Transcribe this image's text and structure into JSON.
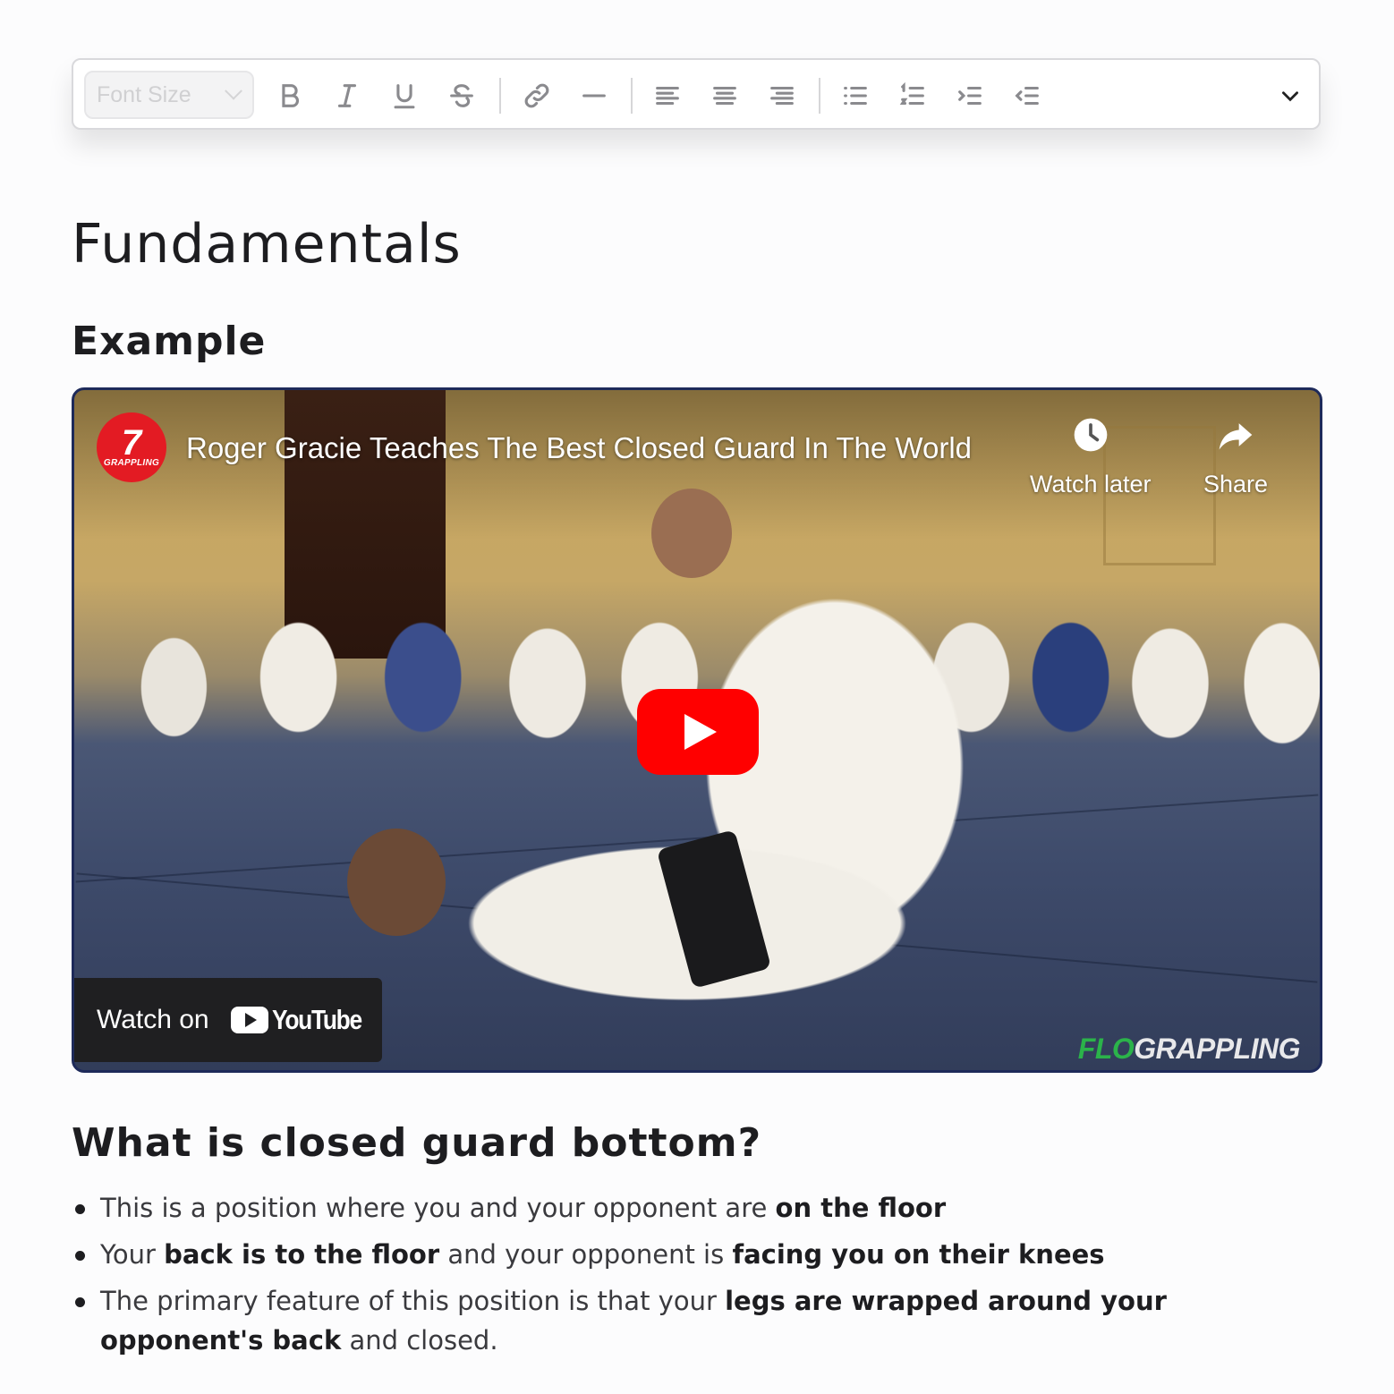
{
  "toolbar": {
    "font_size_placeholder": "Font Size",
    "buttons": [
      "bold",
      "italic",
      "underline",
      "strikethrough",
      "link",
      "horizontal-rule",
      "align-left",
      "align-center",
      "align-right",
      "bullet-list",
      "numbered-list",
      "indent",
      "outdent",
      "more"
    ]
  },
  "document": {
    "title": "Fundamentals",
    "section_example": "Example",
    "section_question": "What is closed guard bottom?"
  },
  "video": {
    "channel_logo_text": "GRAPPLING",
    "title": "Roger Gracie Teaches The Best Closed Guard In The World",
    "watch_later_label": "Watch later",
    "share_label": "Share",
    "watch_on_label": "Watch on",
    "youtube_label": "YouTube",
    "watermark_flo": "FLO",
    "watermark_grappling": "GRAPPLING",
    "colors": {
      "play_button": "#ff0000",
      "channel_red": "#e31b23",
      "flo_green": "#2bb34a",
      "border": "#1e2a5a"
    }
  },
  "bullets": [
    {
      "parts": [
        {
          "t": "This is a position where you and your opponent are ",
          "b": false
        },
        {
          "t": "on the floor",
          "b": true
        }
      ]
    },
    {
      "parts": [
        {
          "t": "Your ",
          "b": false
        },
        {
          "t": "back is to the floor",
          "b": true
        },
        {
          "t": " and your opponent is ",
          "b": false
        },
        {
          "t": "facing you on their knees",
          "b": true
        }
      ]
    },
    {
      "parts": [
        {
          "t": "The primary feature of this position is that your ",
          "b": false
        },
        {
          "t": "legs are wrapped around your opponent's back",
          "b": true
        },
        {
          "t": " and closed.",
          "b": false
        }
      ]
    }
  ]
}
